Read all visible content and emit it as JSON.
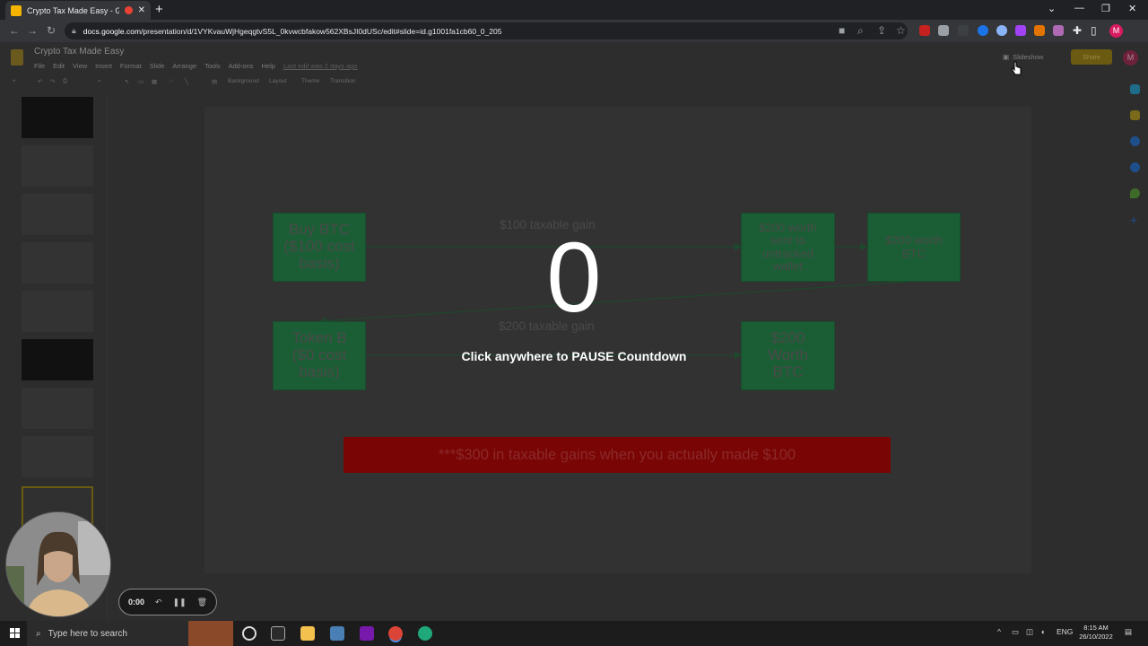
{
  "browser": {
    "tab_title": "Crypto Tax Made Easy - Goo",
    "tab_close": "✕",
    "new_tab": "+",
    "url_host": "docs.google.com",
    "url_path": "/presentation/d/1VYKvauWjHgeqgtvS5L_0kvwcbfakow562XBsJI0dUSc/edit#slide=id.g1001fa1cb60_0_205",
    "window_controls": [
      "⌄",
      "—",
      "❐",
      "✕"
    ]
  },
  "docs": {
    "title": "Crypto Tax Made Easy",
    "menus": [
      "File",
      "Edit",
      "View",
      "Insert",
      "Format",
      "Slide",
      "Arrange",
      "Tools",
      "Add-ons",
      "Help"
    ],
    "last_edit": "Last edit was 2 days ago",
    "toolbar_items": [
      "Background",
      "Layout",
      "Theme",
      "Transition"
    ],
    "slideshow_label": "Slideshow",
    "share_label": "Share",
    "avatar_letter": "M"
  },
  "slide": {
    "box_buy_btc": "Buy BTC\n($100 cost\nbasis)",
    "box_sent_untracked": "$200 worth\nsent to\nuntracked\nwallet",
    "box_200_btc": "$200 worth\nBTC",
    "box_token_b": "Token B\n($0 cost\nbasis)",
    "box_200_worth_btc": "$200\nWorth\nBTC",
    "gain_top": "$100 taxable gain",
    "gain_bottom": "$200 taxable gain",
    "warning": "***$300 in taxable gains when you actually made $100"
  },
  "overlay": {
    "countdown": "0",
    "message": "Click anywhere to PAUSE Countdown"
  },
  "recorder": {
    "time": "0:00"
  },
  "taskbar": {
    "search_placeholder": "Type here to search",
    "language": "ENG",
    "time": "8:15 AM",
    "date": "26/10/2022"
  },
  "colors": {
    "slide_box": "#1b5e35",
    "warning_bar": "#7a0505",
    "share_button": "#6b5a12"
  }
}
